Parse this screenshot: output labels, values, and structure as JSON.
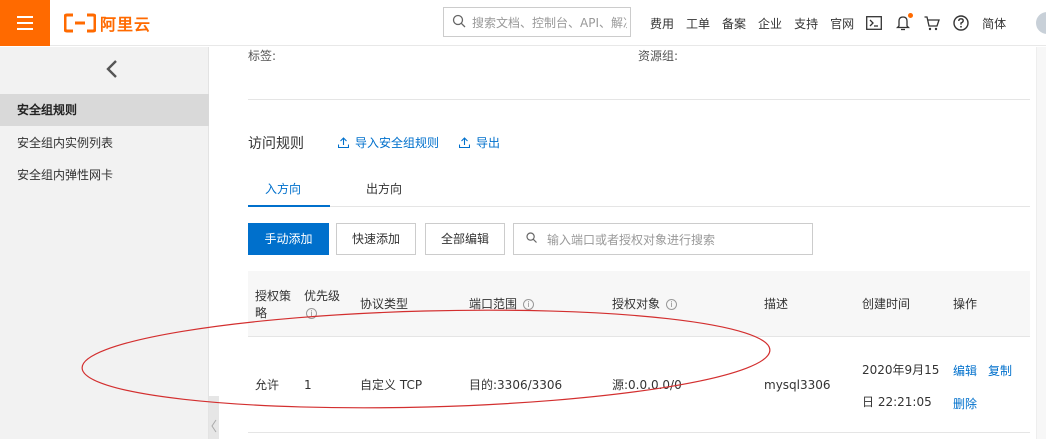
{
  "header": {
    "logo_text": "阿里云",
    "search_placeholder": "搜索文档、控制台、API、解决方案和资源",
    "links": [
      "费用",
      "工单",
      "备案",
      "企业",
      "支持",
      "官网"
    ],
    "lang": "简体",
    "accent_color": "#ff6a00"
  },
  "sidebar": {
    "items": [
      {
        "label": "安全组规则",
        "active": true
      },
      {
        "label": "安全组内实例列表",
        "active": false
      },
      {
        "label": "安全组内弹性网卡",
        "active": false
      }
    ]
  },
  "info": {
    "tags_label": "标签:",
    "resource_group_label": "资源组:"
  },
  "rules": {
    "title": "访问规则",
    "import_label": "导入安全组规则",
    "export_label": "导出",
    "tabs": [
      {
        "label": "入方向",
        "active": true
      },
      {
        "label": "出方向",
        "active": false
      }
    ],
    "buttons": {
      "manual_add": "手动添加",
      "quick_add": "快速添加",
      "edit_all": "全部编辑"
    },
    "filter_placeholder": "输入端口或者授权对象进行搜索",
    "columns": [
      "授权策略",
      "优先级",
      "协议类型",
      "端口范围",
      "授权对象",
      "描述",
      "创建时间",
      "操作"
    ],
    "rows": [
      {
        "policy": "允许",
        "priority": "1",
        "protocol": "自定义 TCP",
        "port": "目的:3306/3306",
        "source": "源:0.0.0.0/0",
        "desc": "mysql3306",
        "created_line1": "2020年9月15",
        "created_line2": "日 22:21:05",
        "actions": [
          "编辑",
          "复制",
          "删除"
        ]
      }
    ]
  },
  "link_color": "#0070cc"
}
